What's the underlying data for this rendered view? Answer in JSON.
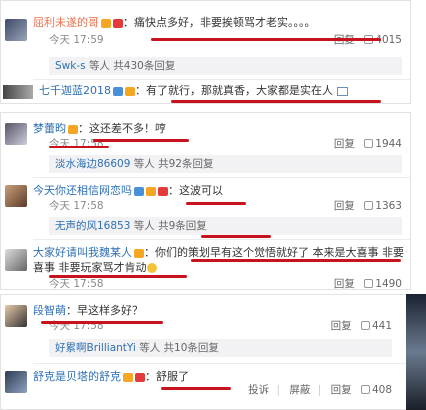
{
  "comments": [
    {
      "id": "c1",
      "avatar_icon": "user-avatar-icon",
      "user": "屈利未遂的哥",
      "text": "：痛快点多好，非要挨顿骂才老实。。。。",
      "time": "今天 17:59",
      "reply_label": "回复",
      "like_count": "4015",
      "replies_summary": {
        "names": "Swk-s",
        "suffix": "等人 共430条回复"
      }
    },
    {
      "id": "c2",
      "user": "七千迦蓝2018",
      "text": "：有了就行，那就真香，大家都是实在人"
    },
    {
      "id": "c3",
      "user": "梦蕾昀",
      "text": "：这还差不多！哼",
      "time": "今天 17:58",
      "reply_label": "回复",
      "like_count": "1944",
      "replies_summary": {
        "names": "淡水海边86609",
        "suffix": "等人 共92条回复"
      }
    },
    {
      "id": "c4",
      "user": "今天你还相信网恋吗",
      "text": "：这波可以",
      "time": "今天 17:58",
      "reply_label": "回复",
      "like_count": "1363",
      "replies_summary": {
        "names": "无声的风16853",
        "suffix": "等人 共9条回复"
      }
    },
    {
      "id": "c5",
      "user": "大家好请叫我魏某人",
      "text": "：你们的策划早有这个觉悟就好了 本来是大喜事 非要玩家骂才肯动",
      "line2": "喜事 非要玩家骂才肯动",
      "time": "今天 17:58",
      "reply_label": "回复",
      "like_count": "1490"
    },
    {
      "id": "c6",
      "user": "段智萌",
      "text": "：早这样多好？",
      "time": "今天 17:58",
      "reply_label": "回复",
      "like_count": "441",
      "replies_summary": {
        "names": "好累啊BrilliantYi",
        "suffix": "等人 共10条回复"
      }
    },
    {
      "id": "c7",
      "user": "舒克是贝塔的舒克",
      "text": "：舒服了",
      "report_label": "投诉",
      "block_label": "屏蔽",
      "reply_label": "回复",
      "like_count": "408"
    }
  ],
  "colors": {
    "username": "#eb7350",
    "link": "#2e6fb3",
    "annotation_underline": "#c8131e",
    "reply_bar_bg": "#f2f2f5"
  }
}
